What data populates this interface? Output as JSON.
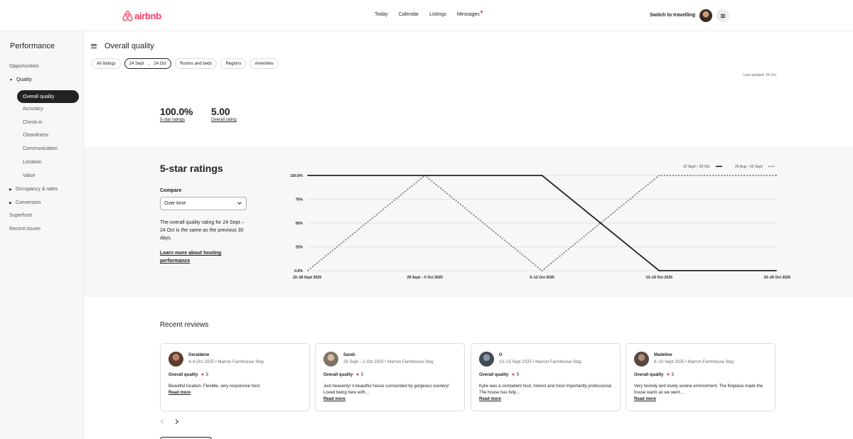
{
  "nav": {
    "logo_text": "airbnb",
    "links": [
      "Today",
      "Calendar",
      "Listings",
      "Messages"
    ],
    "switch_label": "Switch to travelling"
  },
  "sidebar": {
    "title": "Performance",
    "items": {
      "opportunities": "Opportunities",
      "quality": "Quality",
      "overall_quality": "Overall quality",
      "accuracy": "Accuracy",
      "checkin": "Check-in",
      "cleanliness": "Cleanliness",
      "communication": "Communication",
      "location": "Location",
      "value": "Value",
      "occupancy": "Occupancy & rates",
      "conversion": "Conversion",
      "superhost": "Superhost",
      "recent_issues": "Recent issues"
    }
  },
  "header": {
    "title": "Overall quality",
    "last_updated": "Last updated: 24 Oct"
  },
  "filters": {
    "all_listings": "All listings",
    "date_from": "24 Sept",
    "date_arrow": "→",
    "date_to": "24 Oct",
    "rooms": "Rooms and beds",
    "regions": "Regions",
    "amenities": "Amenities"
  },
  "stats": {
    "five_star_value": "100.0%",
    "five_star_label": "5-star ratings",
    "overall_value": "5.00",
    "overall_label": "Overall rating"
  },
  "ratings_panel": {
    "title": "5-star ratings",
    "compare_label": "Compare",
    "compare_value": "Over time",
    "description": "The overall quality rating for 24 Sept – 24 Oct is the same as the previous 30 days.",
    "learn_more": "Learn more about hosting performance"
  },
  "chart_data": {
    "type": "line",
    "categories": [
      "22–28 Sept 2025",
      "29 Sept – 5 Oct 2025",
      "6–12 Oct 2025",
      "13–19 Oct 2025",
      "20–26 Oct 2025"
    ],
    "y_ticks": [
      "0.0%",
      "25%",
      "50%",
      "75%",
      "100.0%"
    ],
    "ylim": [
      0,
      100
    ],
    "grid": true,
    "legend_position": "top-right",
    "series": [
      {
        "name": "22 Sept – 20 Oct",
        "style": "solid",
        "color": "#222222",
        "values": [
          100,
          100,
          100,
          0,
          0
        ]
      },
      {
        "name": "25 Aug – 22 Sept",
        "style": "dotted",
        "color": "#717171",
        "values": [
          0,
          100,
          0,
          100,
          100
        ]
      }
    ]
  },
  "reviews": {
    "title": "Recent reviews",
    "quality_label": "Overall quality",
    "read_more": "Read more",
    "items": [
      {
        "name": "Geraldene",
        "meta": "4–6 Oct 2025 • Marron Farmhouse Stay",
        "score": "5",
        "text": "Beautiful location. Flexible, very responsive host."
      },
      {
        "name": "Sarah",
        "meta": "26 Sept – 2 Oct 2025 • Marron Farmhouse Stay",
        "score": "5",
        "text": "Just heavenly! A beautiful house surrounded by gorgeous scenery! Loved being here with…"
      },
      {
        "name": "G",
        "meta": "13–15 Sept 2025 • Marron Farmhouse Stay",
        "score": "5",
        "text": "Kylie was a competent host, honest and most importantly professional. The house has fully…"
      },
      {
        "name": "Madeline",
        "meta": "8–10 Sept 2025 • Marron Farmhouse Stay",
        "score": "5",
        "text": "Very homely and lovely serene environment. The fireplace made the house warm as we went…"
      }
    ]
  },
  "colors": {
    "brand": "#ff385c",
    "star": "#e61e4d",
    "dark": "#222222"
  }
}
